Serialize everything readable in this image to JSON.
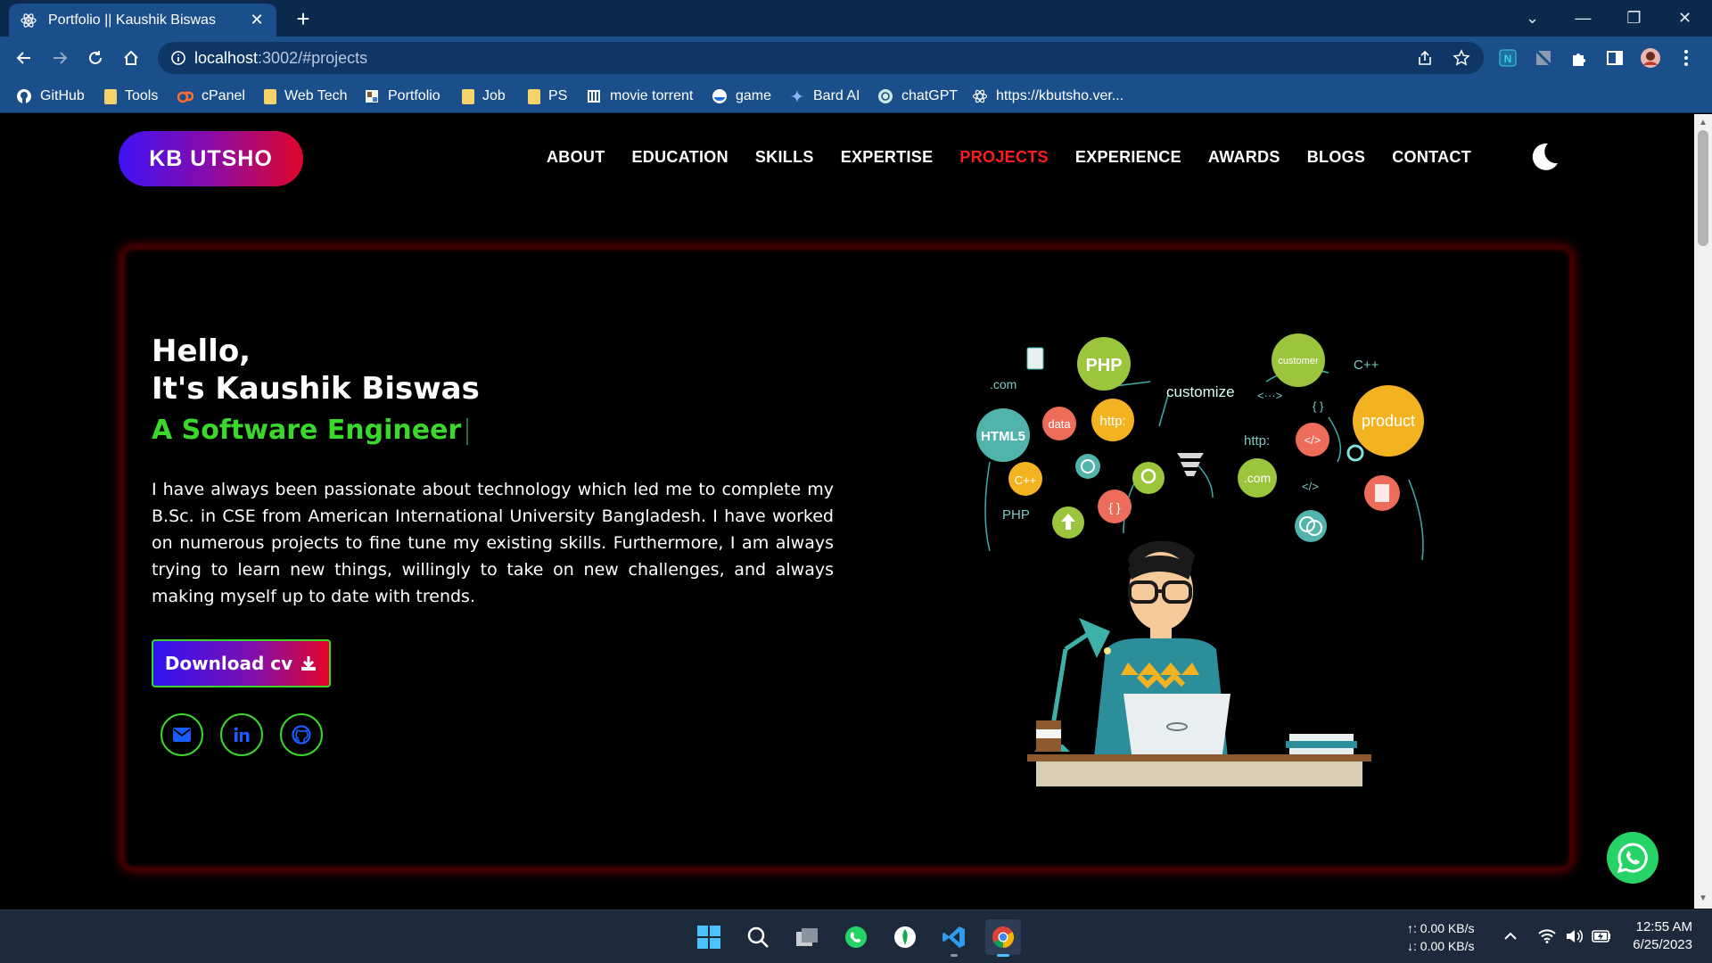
{
  "browser": {
    "tab_title": "Portfolio || Kaushik Biswas",
    "url_host": "localhost",
    "url_rest": ":3002/#projects",
    "bookmarks": [
      {
        "label": "GitHub",
        "icon": "github-icon"
      },
      {
        "label": "Tools",
        "icon": "folder-icon"
      },
      {
        "label": "cPanel",
        "icon": "cpanel-icon"
      },
      {
        "label": "Web Tech",
        "icon": "folder-icon"
      },
      {
        "label": "Portfolio",
        "icon": "portfolio-icon"
      },
      {
        "label": "Job",
        "icon": "folder-icon"
      },
      {
        "label": "PS",
        "icon": "folder-icon"
      },
      {
        "label": "movie torrent",
        "icon": "movie-icon"
      },
      {
        "label": "game",
        "icon": "game-icon"
      },
      {
        "label": "Bard AI",
        "icon": "bard-icon"
      },
      {
        "label": "chatGPT",
        "icon": "chatgpt-icon"
      },
      {
        "label": "https://kbutsho.ver...",
        "icon": "react-icon"
      }
    ]
  },
  "site": {
    "logo": "KB UTSHO",
    "nav": [
      "ABOUT",
      "EDUCATION",
      "SKILLS",
      "EXPERTISE",
      "PROJECTS",
      "EXPERIENCE",
      "AWARDS",
      "BLOGS",
      "CONTACT"
    ],
    "active_nav": "PROJECTS",
    "hero": {
      "greeting": "Hello,",
      "name": "It's Kaushik Biswas",
      "role": "A Software Engineer",
      "bio": "I have always been passionate about technology which led me to complete my B.Sc. in CSE from American International University Bangladesh. I have worked on numerous projects to fine tune my existing skills. Furthermore, I am always trying to learn new things, willingly to take on new challenges, and always making myself up to date with trends.",
      "cv_button": "Download cv"
    },
    "illustration_labels": {
      "php": "PHP",
      "dotcom": ".com",
      "customize": "customize",
      "customer": "customer",
      "cpp": "C++",
      "product": "product",
      "html5": "HTML5",
      "data": "data",
      "http": "http:",
      "http2": "http:",
      "arrows": "<···>",
      "braces": "{ }",
      "code": "</>",
      "cpp2": "C++",
      "php2": "PHP",
      "dotcom2": ".com",
      "code2": "</>",
      "braces2": "{ }"
    }
  },
  "taskbar": {
    "net_up": "↑: 0.00 KB/s",
    "net_down": "↓: 0.00 KB/s",
    "time": "12:55 AM",
    "date": "6/25/2023"
  },
  "colors": {
    "accent_red": "#ff1b1b",
    "accent_green": "#39d82a",
    "chrome_blue": "#1a4f8c"
  }
}
